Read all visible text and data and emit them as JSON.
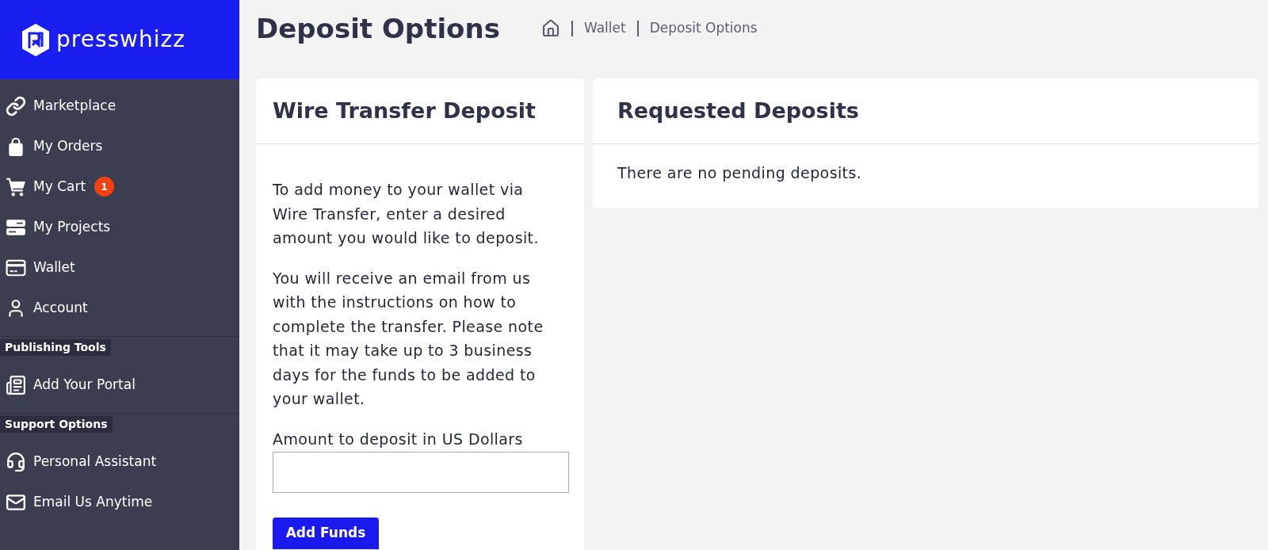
{
  "sidebar": {
    "logo": {
      "text": "presswhizz"
    },
    "sections": [
      {
        "items": [
          {
            "label": "Marketplace"
          },
          {
            "label": "My Orders"
          },
          {
            "label": "My Cart",
            "badge": "1"
          },
          {
            "label": "My Projects"
          },
          {
            "label": "Wallet"
          },
          {
            "label": "Account"
          }
        ]
      },
      {
        "title": "Publishing Tools",
        "items": [
          {
            "label": "Add Your Portal"
          }
        ]
      },
      {
        "title": "Support Options",
        "items": [
          {
            "label": "Personal Assistant"
          },
          {
            "label": "Email Us Anytime"
          }
        ]
      }
    ]
  },
  "header": {
    "title": "Deposit Options",
    "breadcrumb": [
      "Wallet",
      "Deposit Options"
    ]
  },
  "wire_transfer_card": {
    "title": "Wire Transfer Deposit",
    "paragraphs": [
      "To add money to your wallet via Wire Transfer, enter a desired amount you would like to deposit.",
      "You will receive an email from us with the instructions on how to complete the transfer. Please note that it may take up to 3 business days for the funds to be added to your wallet."
    ],
    "amount_field": {
      "label": "Amount to deposit in US Dollars"
    },
    "button": "Add Funds"
  },
  "requested_deposits_card": {
    "title": "Requested Deposits",
    "message": "There are no pending deposits."
  }
}
